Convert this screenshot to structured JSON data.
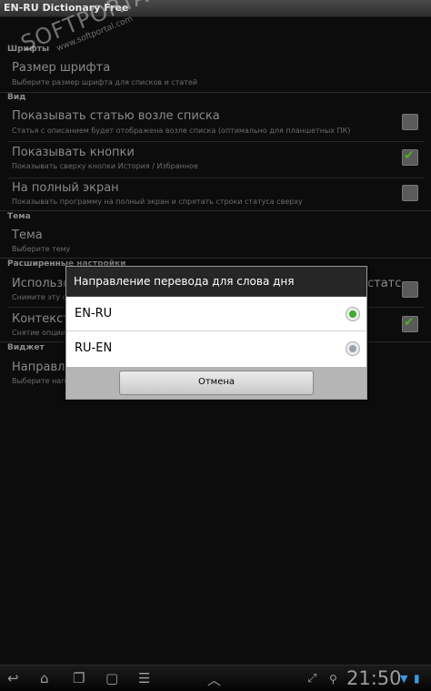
{
  "app": {
    "title": "EN-RU Dictionary Free"
  },
  "watermark": {
    "main": "SOFTPORTAL",
    "sub": "www.softportal.com",
    "mark": "®"
  },
  "settings": {
    "sections": {
      "font": "Шрифты",
      "view": "Вид",
      "theme": "Тема",
      "advanced": "Расширенные настройки",
      "widget": "Виджет"
    },
    "items": [
      {
        "title": "Размер шрифта",
        "subtitle": "Выберите размер шрифта для списков и статей"
      },
      {
        "title": "Показывать статью возле списка",
        "subtitle": "Статья с описанием будет отображена возле списка (оптимально для планшетных ПК)",
        "checked": false
      },
      {
        "title": "Показывать кнопки",
        "subtitle": "Показывать сверху кнопки История / Избранное",
        "checked": true
      },
      {
        "title": "На полный экран",
        "subtitle": "Показывать программу на полный экран и спрятать строки статуса сверху",
        "checked": false
      },
      {
        "title": "Тема",
        "subtitle": "Выберите тему"
      },
      {
        "title": "Использовать",
        "title_right": "статс",
        "subtitle": "Снимите эту оп",
        "checked": false
      },
      {
        "title": "Контекст",
        "subtitle": "Снятие опции",
        "checked": true
      },
      {
        "title": "Направле",
        "subtitle": "Выберите напр"
      }
    ]
  },
  "dialog": {
    "title": "Направление перевода для слова дня",
    "options": [
      {
        "label": "EN-RU",
        "selected": true
      },
      {
        "label": "RU-EN",
        "selected": false
      }
    ],
    "cancel_label": "Отмена"
  },
  "statusbar": {
    "time": "21:50"
  },
  "colors": {
    "radio_selected": "#3aae2a",
    "checkmark": "#4cb020",
    "dialog_title_bg": "#262626"
  }
}
